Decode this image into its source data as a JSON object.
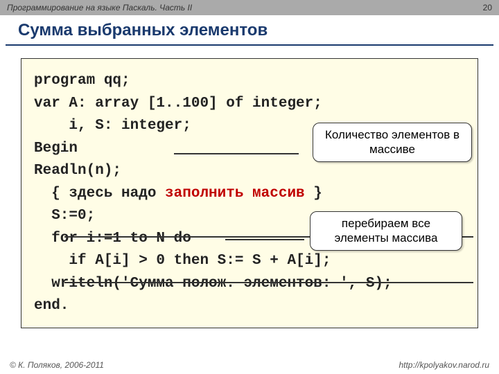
{
  "header": {
    "subject": "Программирование на языке Паскаль. Часть II",
    "page": "20"
  },
  "title": "Сумма выбранных элементов",
  "code": {
    "l1": "program qq;",
    "l2": "var A: array [1..100] of integer;",
    "l3": "    i, S: integer;",
    "l4": "Begin",
    "l5": "Readln(n);",
    "l6a": "  { здесь надо ",
    "l6b": "заполнить массив",
    "l6c": " }",
    "l7a": "  S:=0;",
    "l8a": "  for i:=1 to N do",
    "l9a": "    if A[i] > 0 then S:= S + A[i];",
    "l10": "  writeln('Сумма полож. элементов: ', S);",
    "l11": "end."
  },
  "callouts": {
    "c1": "Количество элементов в массиве",
    "c2": "перебираем все элементы массива"
  },
  "footer": {
    "copyright": "© К. Поляков, 2006-2011",
    "url": "http://kpolyakov.narod.ru"
  }
}
